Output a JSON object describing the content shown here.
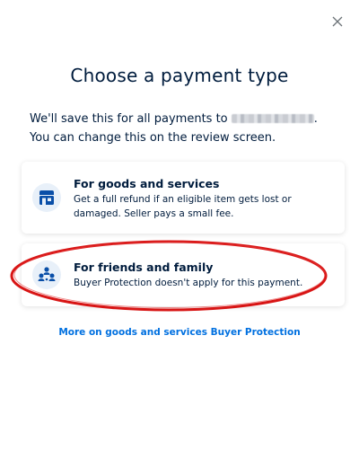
{
  "dialog": {
    "close_icon": "close-icon",
    "title": "Choose a payment type",
    "subtitle_before": "We'll save this for all payments to ",
    "subtitle_after": ". You can change this on the review screen."
  },
  "options": [
    {
      "icon": "storefront-icon",
      "title": "For goods and services",
      "description": "Get a full refund if an eligible item gets lost or damaged. Seller pays a small fee."
    },
    {
      "icon": "people-icon",
      "title": "For friends and family",
      "description": "Buyer Protection doesn't apply for this payment."
    }
  ],
  "link": {
    "label": "More on goods and services Buyer Protection"
  },
  "colors": {
    "primary_text": "#001c3d",
    "link": "#0070e0",
    "icon_blue": "#0a4fa8",
    "highlight_red": "#d81515",
    "icon_bg": "#e8f0f9"
  }
}
